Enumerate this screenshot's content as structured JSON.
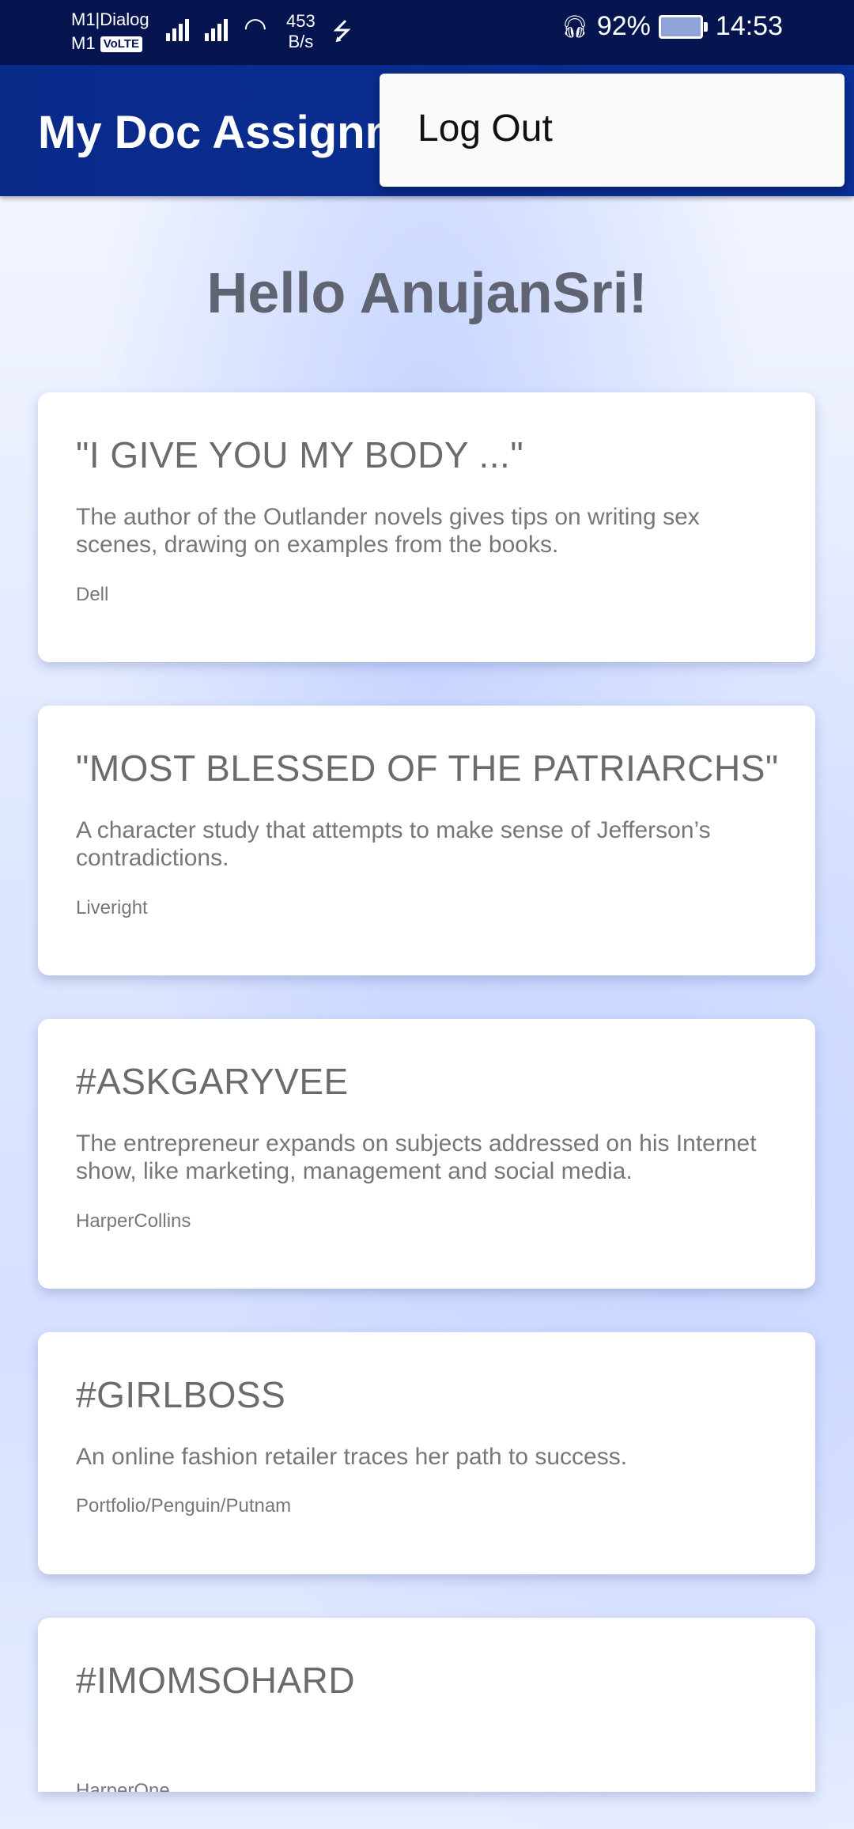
{
  "status_bar": {
    "carrier_line1": "M1|Dialog",
    "carrier_line2": "M1",
    "volte": "VoLTE",
    "speed_value": "453",
    "speed_unit": "B/s",
    "battery": "92%",
    "time": "14:53"
  },
  "app_bar": {
    "title": "My Doc Assignment"
  },
  "menu": {
    "items": [
      "Log Out"
    ]
  },
  "greeting": "Hello AnujanSri!",
  "books": [
    {
      "title": "\"I GIVE YOU MY BODY ...\"",
      "description": "The author of the Outlander novels gives tips on writing sex scenes, drawing on examples from the books.",
      "publisher": "Dell"
    },
    {
      "title": "\"MOST BLESSED OF THE PATRIARCHS\"",
      "description": "A character study that attempts to make sense of Jefferson’s contradictions.",
      "publisher": "Liveright"
    },
    {
      "title": "#ASKGARYVEE",
      "description": "The entrepreneur expands on subjects addressed on his Internet show, like marketing, management and social media.",
      "publisher": "HarperCollins"
    },
    {
      "title": "#GIRLBOSS",
      "description": "An online fashion retailer traces her path to success.",
      "publisher": "Portfolio/Penguin/Putnam"
    },
    {
      "title": "#IMOMSOHARD",
      "description": "",
      "publisher": "HarperOne"
    }
  ]
}
